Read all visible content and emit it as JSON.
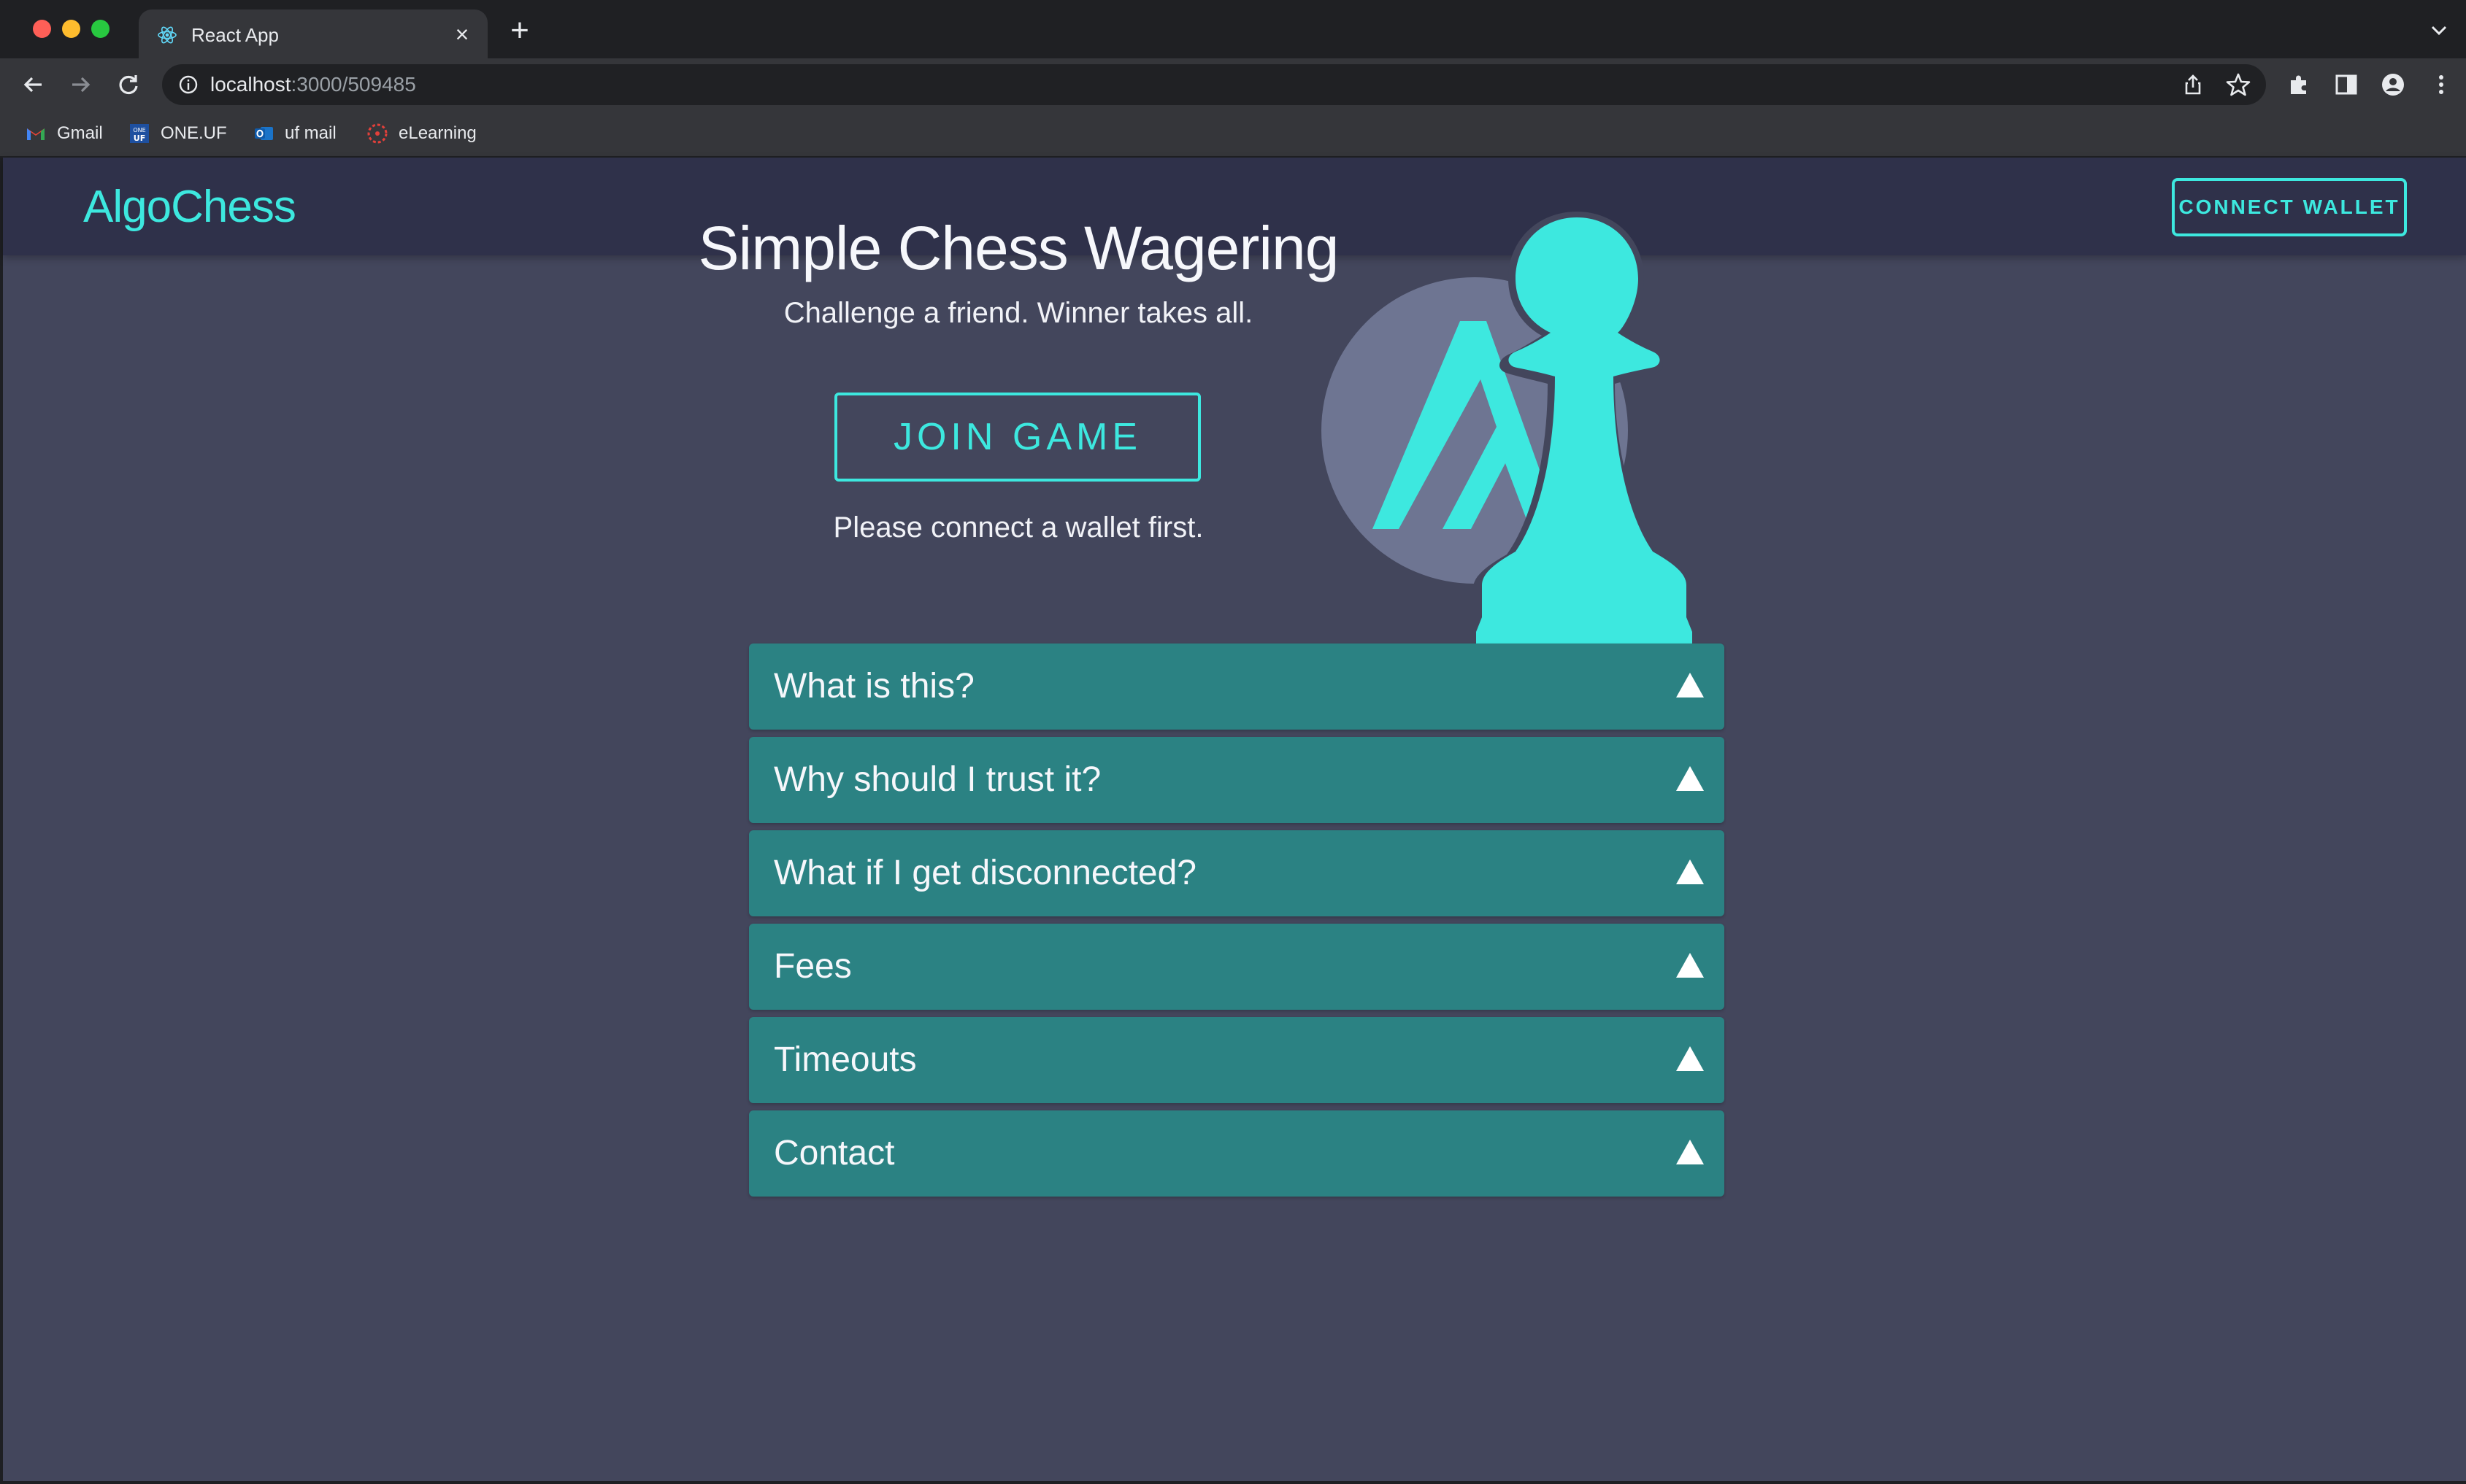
{
  "browser": {
    "tab_title": "React App",
    "url_host": "localhost",
    "url_path": ":3000/509485",
    "bookmarks": [
      {
        "label": "Gmail",
        "icon": "gmail-icon"
      },
      {
        "label": "ONE.UF",
        "icon": "one-uf-icon"
      },
      {
        "label": "uf mail",
        "icon": "outlook-icon"
      },
      {
        "label": "eLearning",
        "icon": "elearning-icon"
      }
    ]
  },
  "app": {
    "brand": "AlgoChess",
    "connect_wallet_label": "CONNECT WALLET",
    "hero": {
      "title": "Simple Chess Wagering",
      "subtitle": "Challenge a friend. Winner takes all.",
      "join_label": "JOIN GAME",
      "note": "Please connect a wallet first."
    },
    "faq": [
      {
        "label": "What is this?"
      },
      {
        "label": "Why should I trust it?"
      },
      {
        "label": "What if I get disconnected?"
      },
      {
        "label": "Fees"
      },
      {
        "label": "Timeouts"
      },
      {
        "label": "Contact"
      }
    ],
    "colors": {
      "accent": "#3de8df",
      "appbar": "#2f314a",
      "background": "#43465c",
      "faq_item": "#2b8283",
      "algo_circle": "#6e7592"
    }
  }
}
